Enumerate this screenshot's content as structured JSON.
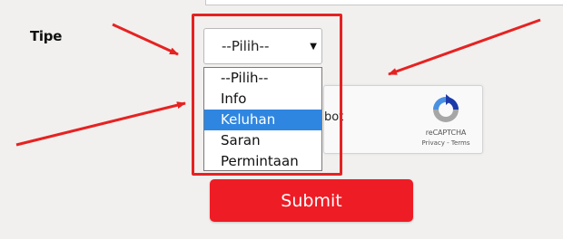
{
  "form": {
    "tipe_label": "Tipe",
    "select": {
      "selected_value": "--Pilih--",
      "options": [
        {
          "label": "--Pilih--",
          "highlighted": false
        },
        {
          "label": "Info",
          "highlighted": false
        },
        {
          "label": "Keluhan",
          "highlighted": true
        },
        {
          "label": "Saran",
          "highlighted": false
        },
        {
          "label": "Permintaan",
          "highlighted": false
        }
      ]
    },
    "captcha": {
      "partial_text": "bot",
      "brand": "reCAPTCHA",
      "links": "Privacy - Terms"
    },
    "submit_label": "Submit"
  },
  "annotation": {
    "color": "#e62222"
  },
  "colors": {
    "submit": "#ee1c25",
    "option_highlight": "#2f86e0",
    "background": "#f1f0ee"
  }
}
